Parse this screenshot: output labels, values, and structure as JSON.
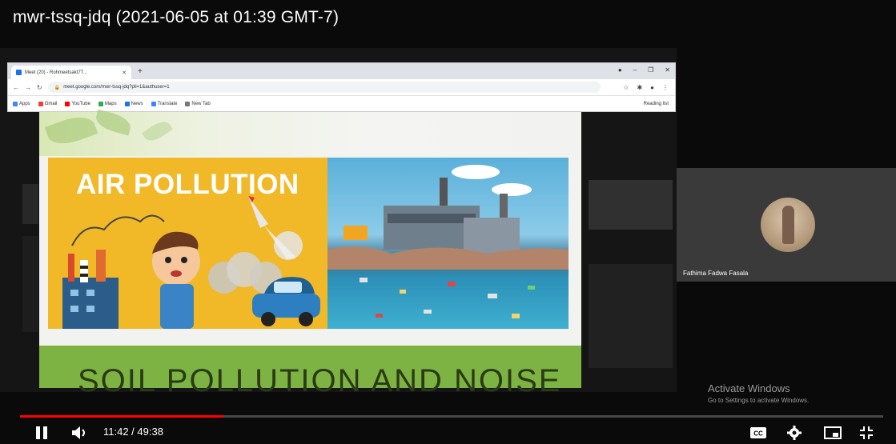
{
  "video": {
    "title": "mwr-tssq-jdq (2021-06-05 at 01:39 GMT-7)",
    "current_time": "11:42",
    "duration": "49:38",
    "time_display": "11:42 / 49:38",
    "progress_fraction": 0.236,
    "buffered_fraction": 0.236
  },
  "browser": {
    "tab_title": "Meet (20) - Rohmeetsakt7T...",
    "url": "meet.google.com/mwr-tssq-jdq?pli=1&authuser=1",
    "bookmarks": [
      "Apps",
      "Gmail",
      "YouTube",
      "Maps",
      "News",
      "Translate",
      "New Tab"
    ],
    "reading_list": "Reading list"
  },
  "slide": {
    "air_title": "AIR POLLUTION",
    "green_title": "SOIL POLLUTION AND NOISE"
  },
  "participant": {
    "name": "Fathima Fadwa Fasala"
  },
  "watermark": {
    "title": "Activate Windows",
    "subtitle": "Go to Settings to activate Windows."
  },
  "colors": {
    "progress": "#ff0000",
    "slide_yellow": "#f1b927",
    "slide_green": "#7cb342"
  },
  "icons": {
    "pause": "pause-icon",
    "volume": "volume-icon",
    "captions": "captions-icon",
    "settings": "gear-icon",
    "miniplayer": "miniplayer-icon",
    "exit_fullscreen": "exit-fullscreen-icon"
  }
}
